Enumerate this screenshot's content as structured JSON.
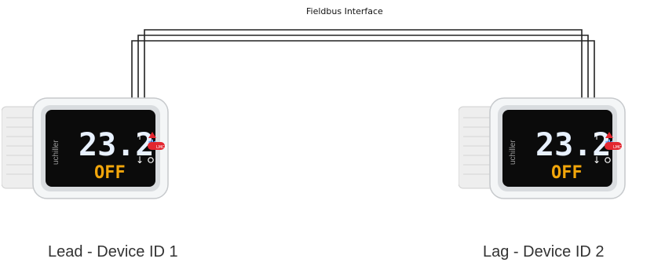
{
  "bus": {
    "title": "Fieldbus Interface"
  },
  "devices": [
    {
      "label": "Lead - Device ID 1",
      "brand": "uchiller",
      "temp": "23.2",
      "status": "OFF",
      "badge": "LMCS"
    },
    {
      "label": "Lag - Device ID 2",
      "brand": "uchiller",
      "temp": "23.2",
      "status": "OFF",
      "badge": "LMCS"
    }
  ],
  "colors": {
    "display_bg": "#0b0b0b",
    "temp_digits": "#e8f1ff",
    "status_digits": "#f2a60b",
    "alarm": "#e3262f",
    "snow": "#6fa8ff"
  },
  "icons": [
    "snowflake-icon",
    "up-arrow-icon",
    "down-arrow-icon",
    "alarm-triangle-icon",
    "set-button-icon"
  ]
}
